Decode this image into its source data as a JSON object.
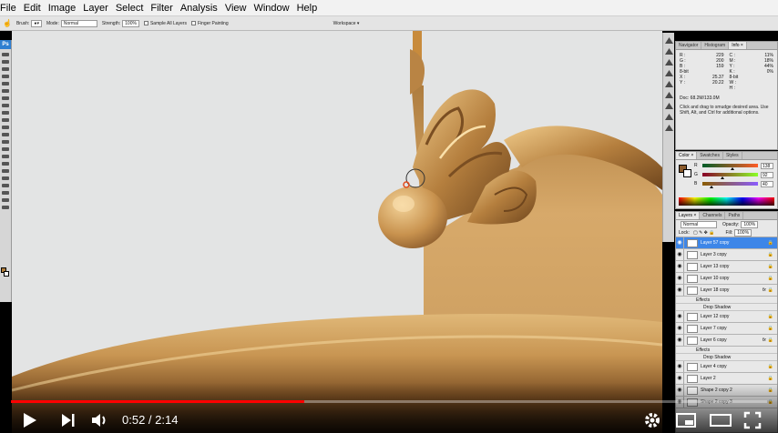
{
  "menubar": {
    "items": [
      "File",
      "Edit",
      "Image",
      "Layer",
      "Select",
      "Filter",
      "Analysis",
      "View",
      "Window",
      "Help"
    ]
  },
  "options": {
    "brush_label": "Brush:",
    "mode_label": "Mode:",
    "mode_value": "Normal",
    "strength_label": "Strength:",
    "strength_value": "100%",
    "sample_all_layers": "Sample All Layers",
    "finger_painting": "Finger Painting",
    "workspace": "Workspace ▾"
  },
  "tools": {
    "logo": "Ps"
  },
  "nav_panel": {
    "tabs": [
      "Navigator",
      "Histogram",
      "Info ×"
    ],
    "rgb": [
      [
        "R :",
        "229"
      ],
      [
        "G :",
        "200"
      ],
      [
        "B :",
        "159"
      ]
    ],
    "cmyk": [
      [
        "C :",
        "11%"
      ],
      [
        "M :",
        "18%"
      ],
      [
        "Y :",
        "44%"
      ],
      [
        "K :",
        "0%"
      ]
    ],
    "bit_left": "8-bit",
    "bit_right": "8-bit",
    "xy": [
      [
        "X :",
        "25.37"
      ],
      [
        "Y :",
        "20.22"
      ]
    ],
    "wh": [
      [
        "W :",
        ""
      ],
      [
        "H :",
        ""
      ]
    ],
    "doc": "Doc: 68.2M/133.0M",
    "hint": "Click and drag to smudge desired area. Use Shift, Alt, and Ctrl for additional options."
  },
  "color_panel": {
    "tabs": [
      "Color ×",
      "Swatches",
      "Styles"
    ],
    "channels": [
      {
        "label": "R",
        "value": "138",
        "marker": 0.54
      },
      {
        "label": "G",
        "value": "92",
        "marker": 0.36
      },
      {
        "label": "B",
        "value": "40",
        "marker": 0.16
      }
    ]
  },
  "layers_panel": {
    "tabs": [
      "Layers ×",
      "Channels",
      "Paths"
    ],
    "blend_mode": "Normal",
    "opacity_label": "Opacity:",
    "opacity_value": "100%",
    "lock_label": "Lock:",
    "fill_label": "Fill:",
    "fill_value": "100%",
    "layers": [
      {
        "name": "Layer 57 copy",
        "selected": true,
        "fx": false
      },
      {
        "name": "Layer 3 copy",
        "selected": false,
        "fx": false
      },
      {
        "name": "Layer 13 copy",
        "selected": false,
        "fx": false
      },
      {
        "name": "Layer 10 copy",
        "selected": false,
        "fx": false
      },
      {
        "name": "Layer 18 copy",
        "selected": false,
        "fx": true
      },
      {
        "name": "Layer 12 copy",
        "selected": false,
        "fx": false
      },
      {
        "name": "Layer 7 copy",
        "selected": false,
        "fx": false
      },
      {
        "name": "Layer 6 copy",
        "selected": false,
        "fx": true
      },
      {
        "name": "Layer 4 copy",
        "selected": false,
        "fx": false
      },
      {
        "name": "Layer 2",
        "selected": false,
        "fx": false
      },
      {
        "name": "Shape 2 copy 2",
        "selected": false,
        "fx": false
      },
      {
        "name": "Shape 2 copy 3",
        "selected": false,
        "fx": false
      }
    ],
    "effects_label": "Effects",
    "drop_shadow_label": "Drop Shadow"
  },
  "video": {
    "time": "0:52 / 2:14",
    "progress": 0.388
  }
}
